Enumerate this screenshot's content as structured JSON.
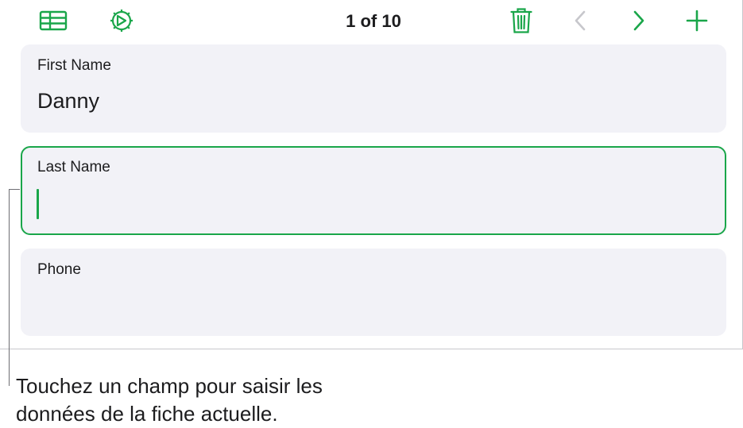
{
  "toolbar": {
    "table_icon": "table-icon",
    "settings_icon": "gear-icon",
    "record_counter": "1 of 10",
    "delete_icon": "trash-icon",
    "prev_icon": "chevron-left-icon",
    "next_icon": "chevron-right-icon",
    "add_icon": "plus-icon",
    "accent_color": "#1aa64a",
    "disabled_color": "#c7c7cc"
  },
  "fields": [
    {
      "label": "First Name",
      "value": "Danny",
      "active": false
    },
    {
      "label": "Last Name",
      "value": "",
      "active": true
    },
    {
      "label": "Phone",
      "value": "",
      "active": false
    }
  ],
  "callout": {
    "line1": "Touchez un champ pour saisir les",
    "line2": "données de la fiche actuelle."
  }
}
